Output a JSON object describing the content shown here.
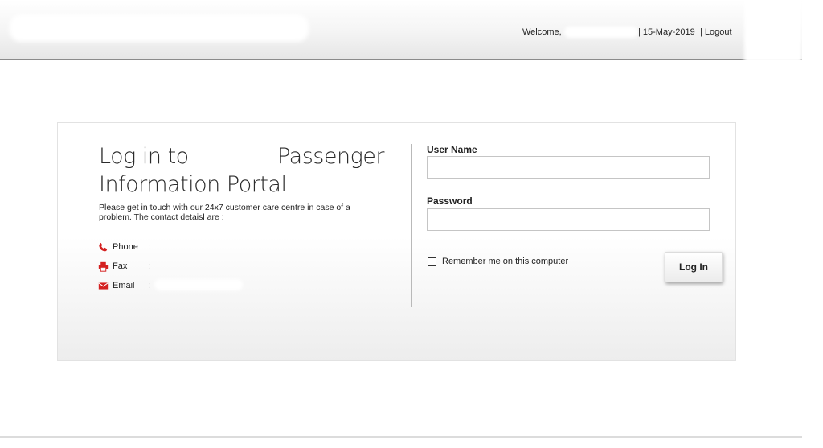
{
  "header": {
    "welcome": "Welcome,",
    "date": "| 15-May-2019",
    "logout": "| Logout"
  },
  "login": {
    "title_line1_a": "Log in to",
    "title_line1_b": "Passenger",
    "title_line2": "Information Portal",
    "description": "Please get in touch with our 24x7 customer care centre in case of a problem. The contact detaisl are :",
    "contacts": [
      {
        "label": "Phone",
        "sep": ":",
        "icon": "phone-icon"
      },
      {
        "label": "Fax",
        "sep": ":",
        "icon": "printer-icon"
      },
      {
        "label": "Email",
        "sep": ":",
        "icon": "envelope-icon"
      }
    ],
    "username_label": "User Name",
    "password_label": "Password",
    "remember_label": "Remember me on this computer",
    "login_button": "Log In"
  },
  "colors": {
    "icon_red": "#d42020",
    "border": "#c5c5c5"
  }
}
